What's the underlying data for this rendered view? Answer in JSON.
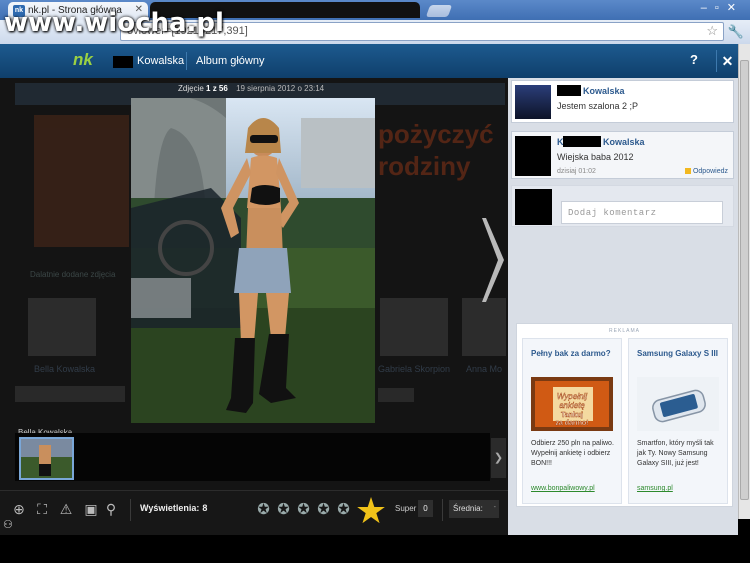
{
  "browser": {
    "tab_title": "nk.pl - Strona główna",
    "tab_favicon": "nk",
    "address": "oviewer=[19219217,391]",
    "watermark": "www.wiocha.pl"
  },
  "nk_header": {
    "logo": "nk",
    "user_name": "Kowalska",
    "album_label": "Album główny",
    "help": "?",
    "close": "✕"
  },
  "viewer": {
    "counter_prefix": "Zdjęcie",
    "counter_value": "1 z 56",
    "date": "19 sierpnia 2012 o 23:14",
    "owner": "Bella Kowalska",
    "strip_next": "❯"
  },
  "background_page": {
    "headline": "pożyczyć\nrodziny",
    "section_label": "Dalatnie dodane zdjęcia",
    "thumb_captions": [
      "Bella Kowalska",
      "Gabriela Skorpion",
      "Anna Mo"
    ]
  },
  "toolbar": {
    "views_label": "Wyświetlenia:",
    "views_value": "8",
    "rating_stars": [
      "1",
      "2",
      "3",
      "4",
      "5"
    ],
    "big_star_label": "6",
    "super_label": "Super",
    "super_value": "0",
    "avg_label": "Średnia:",
    "avg_value": "-"
  },
  "comments": [
    {
      "name": "Kowalska",
      "text": "Jestem szalona 2 ;P"
    },
    {
      "name_prefix": "K",
      "name": "Kowalska",
      "text": "Wiejska baba 2012",
      "time": "dzisiaj 01:02",
      "reply": "Odpowiedz"
    }
  ],
  "comment_input": {
    "placeholder": "Dodaj komentarz"
  },
  "ad": {
    "header": "REKLAMA",
    "left": {
      "title": "Pełny bak za darmo?",
      "image_text": "Wypełnij ankietę Tankuj za darmo!",
      "body": "Odbierz 250 pln na paliwo. Wypełnij ankietę i odbierz BON!!!",
      "link": "www.bonpaliwowy.pl"
    },
    "right": {
      "title": "Samsung Galaxy S III",
      "body": "Smartfon, który myśli tak jak Ty. Nowy Samsung Galaxy SIII, już jest!",
      "link": "samsung.pl"
    }
  }
}
